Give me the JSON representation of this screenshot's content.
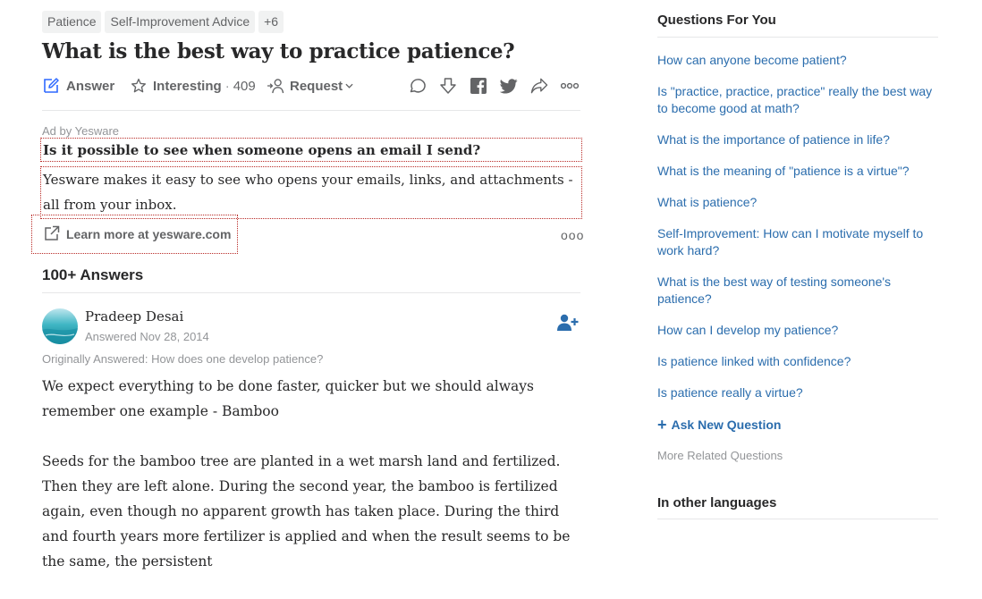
{
  "question": {
    "tags": [
      "Patience",
      "Self-Improvement Advice",
      "+6"
    ],
    "title": "What is the best way to practice patience?",
    "actions": {
      "answer_label": "Answer",
      "interesting_label": "Interesting",
      "interesting_sep": "·",
      "interesting_count": "409",
      "request_label": "Request"
    }
  },
  "ad": {
    "by": "Ad by Yesware",
    "headline": "Is it possible to see when someone opens an email I send?",
    "body": "Yesware makes it easy to see who opens your emails, links, and attachments - all from your inbox.",
    "link_label": "Learn more at yesware.com",
    "more_label": "ooo"
  },
  "answers": {
    "count_label": "100+ Answers",
    "more_label": "ooo",
    "first": {
      "author": "Pradeep Desai",
      "date": "Answered Nov 28, 2014",
      "originally": "Originally Answered: How does one develop patience?",
      "paragraphs": [
        "We expect everything to be done faster, quicker but we should always remember one example - Bamboo",
        "Seeds for the  bamboo tree are planted in a wet marsh land and fertilized. Then they are left alone. During the second year, the bamboo is fertilized again, even though no apparent growth has taken place. During the third and fourth years more fertilizer is applied and when the result seems to be the same, the persistent"
      ]
    }
  },
  "sidebar": {
    "title": "Questions For You",
    "questions": [
      "How can anyone become patient?",
      "Is \"practice, practice, practice\" really the best way to become good at math?",
      "What is the importance of patience in life?",
      "What is the meaning of \"patience is a virtue\"?",
      "What is patience?",
      "Self-Improvement: How can I motivate myself to work hard?",
      "What is the best way of testing someone's patience?",
      "How can I develop my patience?",
      "Is patience linked with confidence?",
      "Is patience really a virtue?"
    ],
    "ask_new_label": "Ask New Question",
    "more_related_label": "More Related Questions",
    "other_languages_label": "In other languages"
  },
  "colors": {
    "link": "#2b6dad",
    "ad_outline": "#b92b27",
    "muted": "#939598",
    "text": "#282829"
  }
}
